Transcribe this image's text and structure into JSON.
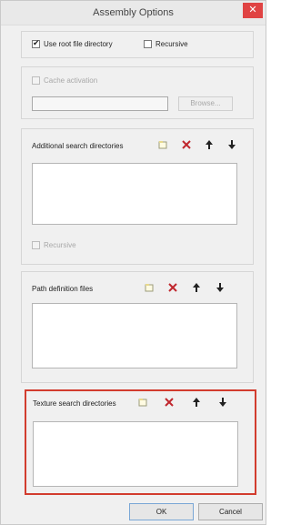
{
  "window": {
    "title": "Assembly Options",
    "close_glyph": "✕"
  },
  "root": {
    "use_root_label": "Use root file directory",
    "use_root_checked": true,
    "recursive_label": "Recursive",
    "recursive_checked": false
  },
  "cache": {
    "activation_label": "Cache activation",
    "path_value": "",
    "browse_label": "Browse..."
  },
  "additional": {
    "title": "Additional search directories",
    "recursive_label": "Recursive"
  },
  "path_def": {
    "title": "Path definition files"
  },
  "texture": {
    "title": "Texture search directories"
  },
  "footer": {
    "ok_label": "OK",
    "cancel_label": "Cancel"
  },
  "icons": {
    "new": "new-folder-icon",
    "delete": "delete-icon",
    "up": "move-up-icon",
    "down": "move-down-icon"
  },
  "colors": {
    "delete": "#c0272d",
    "highlight": "#d23c2e",
    "close": "#e04343"
  }
}
